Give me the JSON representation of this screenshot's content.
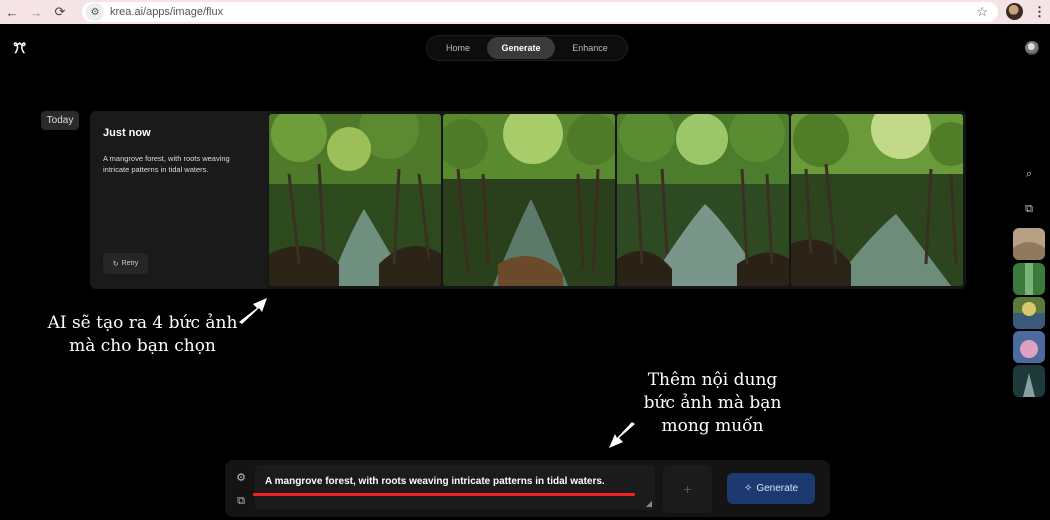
{
  "browser": {
    "url": "krea.ai/apps/image/flux",
    "back_icon": "←",
    "forward_icon": "→",
    "reload_icon": "⟳",
    "site_info_icon": "⚙",
    "star_icon": "☆",
    "menu_icon": "⋮"
  },
  "app": {
    "logo_glyph": "ꔫ",
    "tabs": [
      {
        "label": "Home"
      },
      {
        "label": "Generate"
      },
      {
        "label": "Enhance"
      }
    ],
    "active_tab": "Generate"
  },
  "history": {
    "date_group": "Today",
    "entry": {
      "time": "Just now",
      "prompt": "A mangrove forest, with roots weaving intricate patterns in tidal waters.",
      "retry_label": "Retry",
      "retry_icon": "↻"
    }
  },
  "rail": {
    "search_icon": "⌕",
    "share_icon": "⧉"
  },
  "annotations": {
    "left": "AI sẽ tạo ra 4 bức ảnh mà cho bạn chọn",
    "right": "Thêm nội dung bức ảnh mà bạn mong muốn"
  },
  "prompt_bar": {
    "settings_icon": "⚙",
    "share_icon": "⧉",
    "value": "A mangrove forest, with roots weaving intricate patterns in tidal waters.",
    "add_icon": "+",
    "generate_label": "Generate",
    "generate_icon": "✧"
  },
  "colors": {
    "accent_button": "#1c3a6f",
    "highlight_underline": "#e22222",
    "browser_chrome": "#f6e3e6"
  }
}
